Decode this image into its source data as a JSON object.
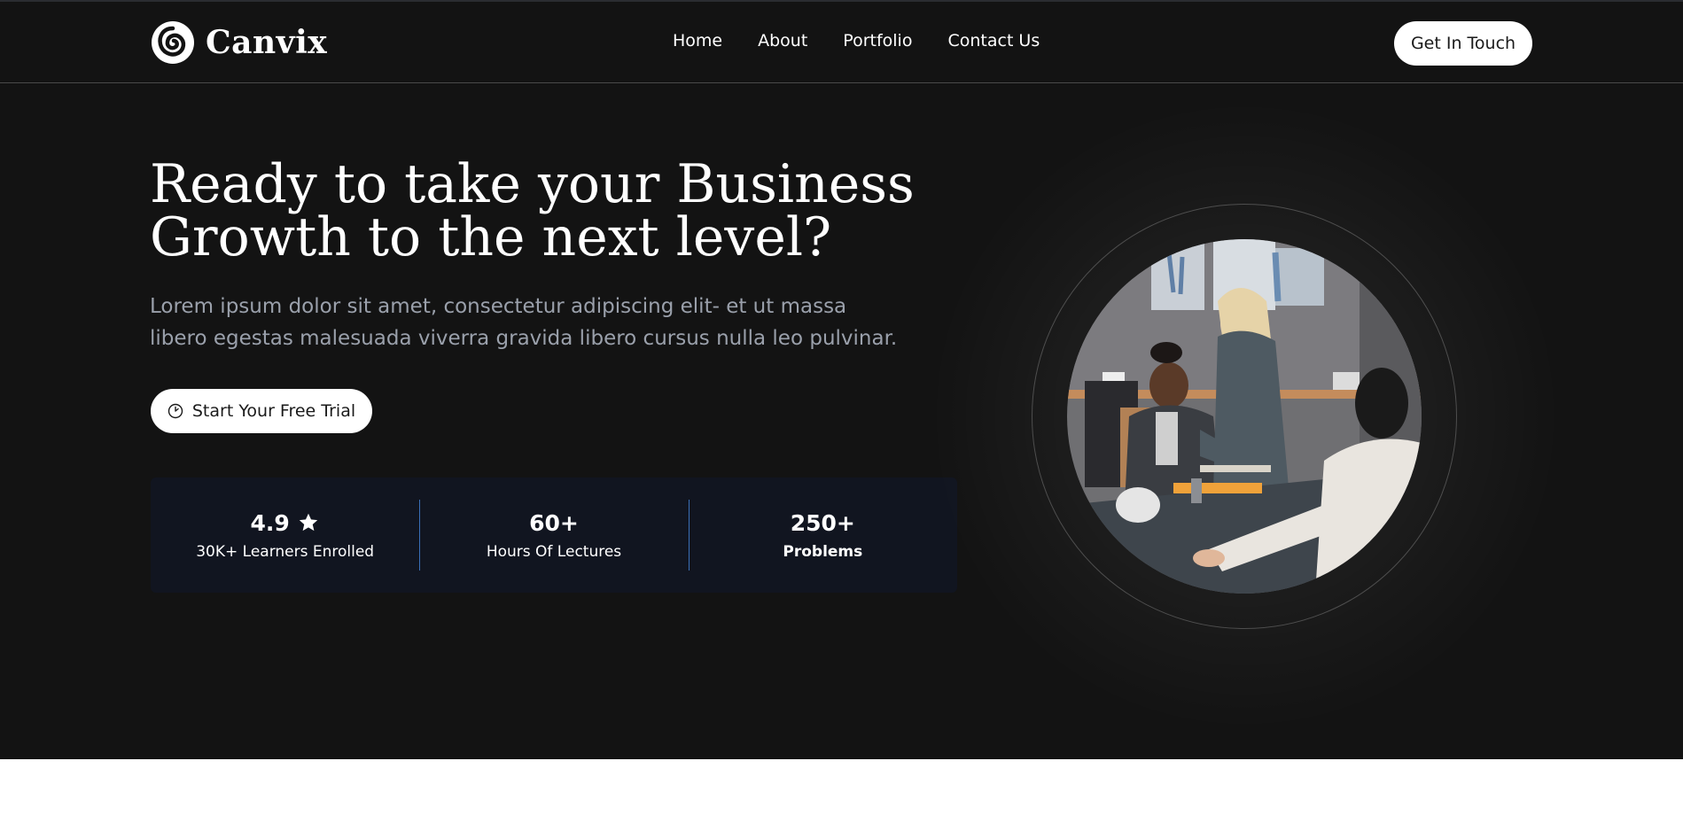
{
  "brand": {
    "name": "Canvix"
  },
  "nav": {
    "items": [
      {
        "label": "Home"
      },
      {
        "label": "About"
      },
      {
        "label": "Portfolio"
      },
      {
        "label": "Contact Us"
      }
    ],
    "cta_label": "Get In Touch"
  },
  "hero": {
    "headline_line1": "Ready to take your Business",
    "headline_line2": "Growth to the next level?",
    "subtext_line1": "Lorem ipsum dolor sit amet, consectetur adipiscing elit- et ut massa",
    "subtext_line2": "libero egestas malesuada viverra gravida libero cursus nulla leo pulvinar.",
    "trial_button_label": "Start Your Free Trial",
    "trial_button_icon": "clock-icon"
  },
  "stats": [
    {
      "value": "4.9",
      "label": "30K+ Learners Enrolled",
      "icon": "star-icon"
    },
    {
      "value": "60+",
      "label": "Hours Of Lectures"
    },
    {
      "value": "250+",
      "label": "Problems"
    }
  ],
  "colors": {
    "background": "#131313",
    "stats_panel": "#111520",
    "divider": "#3a6fb7",
    "subtext": "#9aa0ab",
    "white": "#ffffff"
  }
}
